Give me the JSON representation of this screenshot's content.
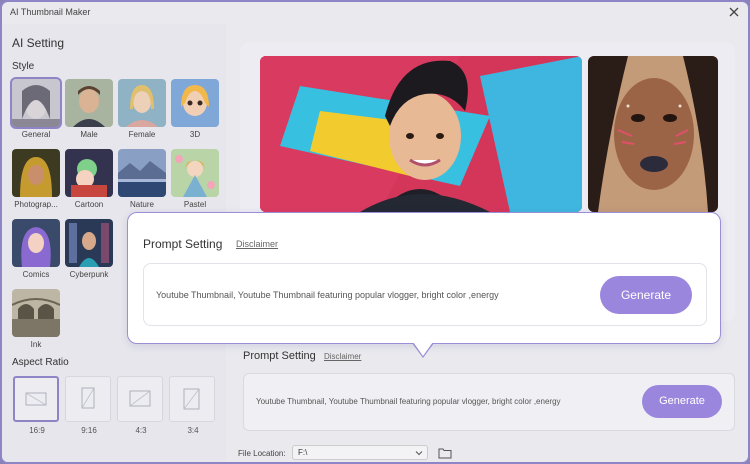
{
  "app_title": "AI Thumbnail Maker",
  "left_panel": {
    "title": "AI Setting",
    "style_label": "Style",
    "styles": [
      {
        "label": "General",
        "selected": true
      },
      {
        "label": "Male",
        "selected": false
      },
      {
        "label": "Female",
        "selected": false
      },
      {
        "label": "3D",
        "selected": false
      },
      {
        "label": "Photograp...",
        "selected": false
      },
      {
        "label": "Cartoon",
        "selected": false
      },
      {
        "label": "Nature",
        "selected": false
      },
      {
        "label": "Pastel",
        "selected": false
      },
      {
        "label": "Comics",
        "selected": false
      },
      {
        "label": "Cyberpunk",
        "selected": false
      },
      {
        "label": "Ink",
        "selected": false
      }
    ],
    "aspect_label": "Aspect Ratio",
    "aspect_ratios": [
      {
        "label": "16:9",
        "selected": true
      },
      {
        "label": "9:16",
        "selected": false
      },
      {
        "label": "4:3",
        "selected": false
      },
      {
        "label": "3:4",
        "selected": false
      }
    ]
  },
  "popup": {
    "title": "Prompt Setting",
    "disclaimer": "Disclaimer",
    "prompt_text": "Youtube Thumbnail, Youtube Thumbnail featuring popular vlogger, bright color ,energy",
    "generate_label": "Generate"
  },
  "bottom_prompt": {
    "title": "Prompt Setting",
    "disclaimer": "Disclaimer",
    "prompt_text": "Youtube Thumbnail, Youtube Thumbnail featuring popular vlogger, bright color ,energy",
    "generate_label": "Generate"
  },
  "file_location": {
    "label": "File Location:",
    "value": "F:\\"
  },
  "colors": {
    "accent": "#9b86de",
    "border_accent": "#8e85c6"
  }
}
